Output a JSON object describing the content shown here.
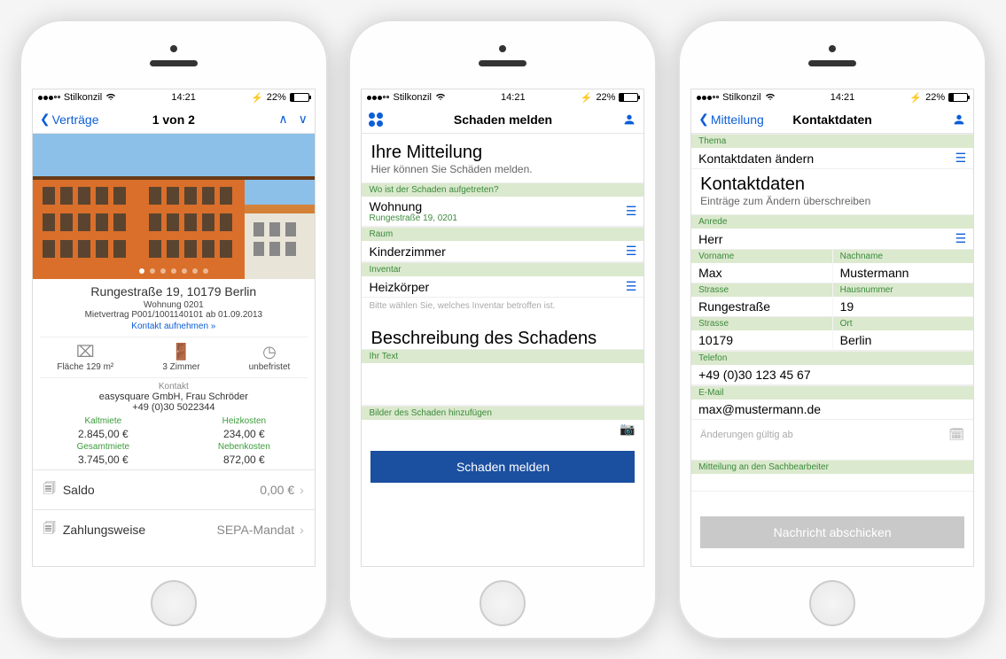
{
  "statusbar": {
    "carrier": "Stilkonzil",
    "time": "14:21",
    "battery": "22%"
  },
  "phone1": {
    "nav": {
      "back": "Verträge",
      "title": "1 von 2"
    },
    "address": "Rungestraße 19, 10179 Berlin",
    "unit": "Wohnung 0201",
    "contract": "Mietvertrag P001/1001140101 ab 01.09.2013",
    "contact_link": "Kontakt aufnehmen »",
    "facts": {
      "area": "Fläche 129 m²",
      "rooms": "3 Zimmer",
      "term": "unbefristet"
    },
    "kontakt_label": "Kontakt",
    "kontakt_name": "easysquare GmbH, Frau Schröder",
    "kontakt_phone": "+49 (0)30 5022344",
    "costs": {
      "kalt_l": "Kaltmiete",
      "kalt_v": "2.845,00 €",
      "heiz_l": "Heizkosten",
      "heiz_v": "234,00 €",
      "gesamt_l": "Gesamtmiete",
      "gesamt_v": "3.745,00 €",
      "neben_l": "Nebenkosten",
      "neben_v": "872,00 €"
    },
    "rows": {
      "saldo_l": "Saldo",
      "saldo_v": "0,00 €",
      "zahl_l": "Zahlungsweise",
      "zahl_v": "SEPA-Mandat"
    }
  },
  "phone2": {
    "nav": {
      "title": "Schaden melden"
    },
    "h1": "Ihre Mitteilung",
    "h1sub": "Hier können Sie Schäden melden.",
    "where_lbl": "Wo ist der Schaden aufgetreten?",
    "where_val": "Wohnung",
    "where_sub": "Rungestraße 19, 0201",
    "room_lbl": "Raum",
    "room_val": "Kinderzimmer",
    "inv_lbl": "Inventar",
    "inv_val": "Heizkörper",
    "inv_hint": "Bitte wählen Sie, welches Inventar betroffen ist.",
    "desc_h": "Beschreibung des Schadens",
    "text_lbl": "Ihr Text",
    "img_lbl": "Bilder des Schaden hinzufügen",
    "submit": "Schaden melden"
  },
  "phone3": {
    "nav": {
      "back": "Mitteilung",
      "title": "Kontaktdaten"
    },
    "thema_lbl": "Thema",
    "thema_val": "Kontaktdaten ändern",
    "h1": "Kontaktdaten",
    "h1sub": "Einträge zum Ändern überschreiben",
    "anrede_lbl": "Anrede",
    "anrede_val": "Herr",
    "vorname_lbl": "Vorname",
    "vorname_val": "Max",
    "nachname_lbl": "Nachname",
    "nachname_val": "Mustermann",
    "strasse_lbl": "Strasse",
    "strasse_val": "Rungestraße",
    "hausnr_lbl": "Hausnummer",
    "hausnr_val": "19",
    "plz_lbl": "Strasse",
    "plz_val": "10179",
    "ort_lbl": "Ort",
    "ort_val": "Berlin",
    "tel_lbl": "Telefon",
    "tel_val": "+49 (0)30 123 45 67",
    "mail_lbl": "E-Mail",
    "mail_val": "max@mustermann.de",
    "gueltig_lbl": "Änderungen gültig ab",
    "msg_lbl": "Mitteilung an den Sachbearbeiter",
    "submit": "Nachricht abschicken"
  }
}
